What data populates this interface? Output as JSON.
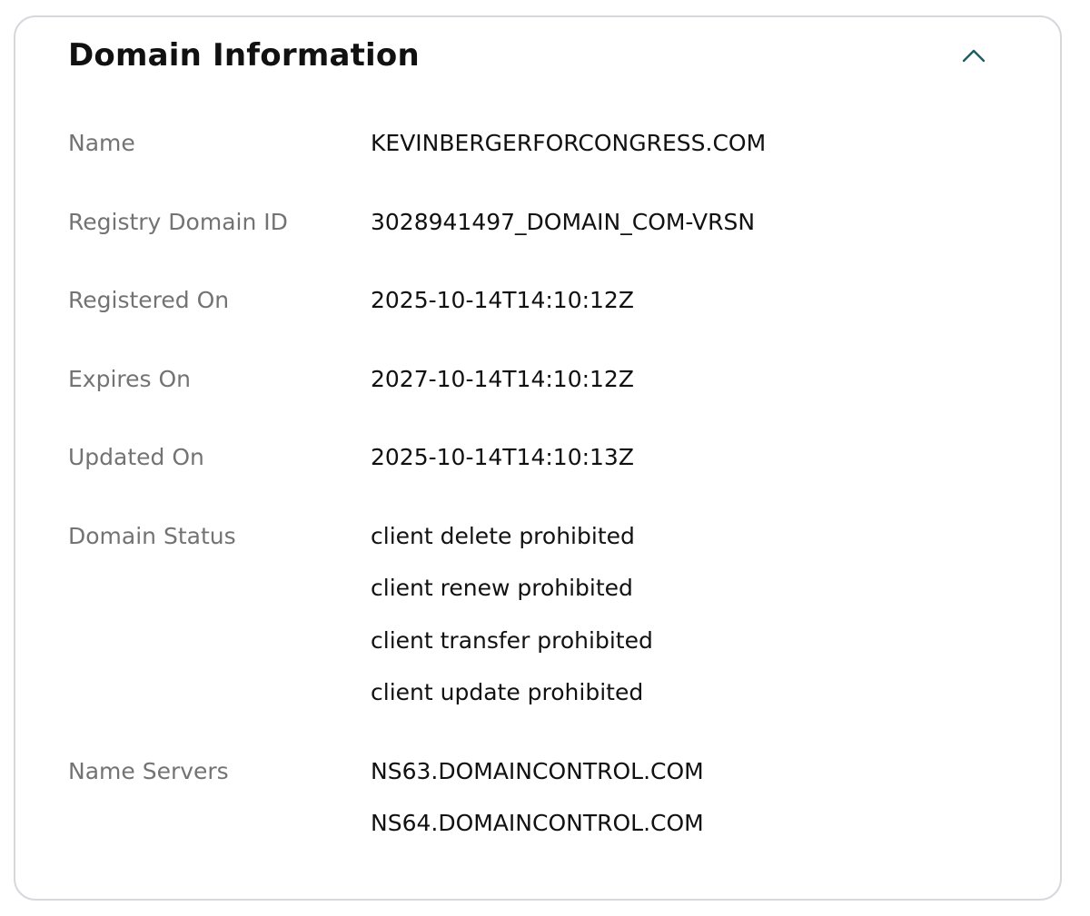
{
  "panel": {
    "title": "Domain Information",
    "toggle_icon": "chevron-up-icon",
    "accent_color": "#1f5c5f"
  },
  "rows": [
    {
      "id": "name",
      "label": "Name",
      "values": [
        "KEVINBERGERFORCONGRESS.COM"
      ]
    },
    {
      "id": "registry-domain-id",
      "label": "Registry Domain ID",
      "values": [
        "3028941497_DOMAIN_COM-VRSN"
      ]
    },
    {
      "id": "registered-on",
      "label": "Registered On",
      "values": [
        "2025-10-14T14:10:12Z"
      ]
    },
    {
      "id": "expires-on",
      "label": "Expires On",
      "values": [
        "2027-10-14T14:10:12Z"
      ]
    },
    {
      "id": "updated-on",
      "label": "Updated On",
      "values": [
        "2025-10-14T14:10:13Z"
      ]
    },
    {
      "id": "domain-status",
      "label": "Domain Status",
      "values": [
        "client delete prohibited",
        "client renew prohibited",
        "client transfer prohibited",
        "client update prohibited"
      ]
    },
    {
      "id": "name-servers",
      "label": "Name Servers",
      "values": [
        "NS63.DOMAINCONTROL.COM",
        "NS64.DOMAINCONTROL.COM"
      ]
    }
  ]
}
